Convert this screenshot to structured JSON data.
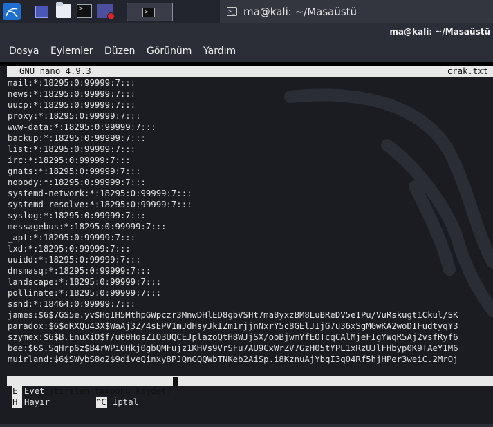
{
  "taskbar": {
    "terminal_glyph": ">_",
    "active_window_title": "ma@kali: ~/Masaüstü"
  },
  "window": {
    "title": "ma@kali: ~/Masaüstü"
  },
  "menu": [
    "Dosya",
    "Eylemler",
    "Düzen",
    "Görünüm",
    "Yardım"
  ],
  "nano": {
    "version": "GNU nano 4.9.3",
    "filename": "crak.txt",
    "lines": [
      "mail:*:18295:0:99999:7:::",
      "news:*:18295:0:99999:7:::",
      "uucp:*:18295:0:99999:7:::",
      "proxy:*:18295:0:99999:7:::",
      "www-data:*:18295:0:99999:7:::",
      "backup:*:18295:0:99999:7:::",
      "list:*:18295:0:99999:7:::",
      "irc:*:18295:0:99999:7:::",
      "gnats:*:18295:0:99999:7:::",
      "nobody:*:18295:0:99999:7:::",
      "systemd-network:*:18295:0:99999:7:::",
      "systemd-resolve:*:18295:0:99999:7:::",
      "syslog:*:18295:0:99999:7:::",
      "messagebus:*:18295:0:99999:7:::",
      "_apt:*:18295:0:99999:7:::",
      "lxd:*:18295:0:99999:7:::",
      "uuidd:*:18295:0:99999:7:::",
      "dnsmasq:*:18295:0:99999:7:::",
      "landscape:*:18295:0:99999:7:::",
      "pollinate:*:18295:0:99999:7:::",
      "sshd:*:18464:0:99999:7:::",
      "james:$6$7GS5e.yv$HqIH5MthpGWpczr3MnwDHlED8gbVSHt7ma8yxzBM8LuBReDV5e1Pu/VuRskugt1Ckul/SK",
      "paradox:$6$oRXQu43X$WaAj3Z/4sEPV1mJdHsyJkIZm1rjjnNxrY5c8GElJIjG7u36xSgMGwKA2woDIFudtyqY3",
      "szymex:$6$B.EnuXiO$f/u00HosZIO3UQCEJplazoQtH8WJjSX/ooBjwmYfEOTcqCAlMjeFIgYWqR5Aj2vsfRyf6",
      "bee:$6$.SqHrp6z$B4rWPi0Hkj0gbQMFujz1KHVs9VrSFu7AU9CxWrZV7GzH05tYPL1xRzUJlFHbyp0K9TAeY1M6",
      "muirland:$6$SWybS8o2$9diveQinxy8PJQnGQQWbTNKeb2AiSp.i8KznuAjYbqI3q04Rf5hjHPer3weiC.2MrOj"
    ],
    "prompt": "Değiştirilen tamponu kaydet?",
    "options": [
      {
        "key": "E",
        "label": "Evet"
      },
      {
        "key": "H",
        "label": "Hayır"
      },
      {
        "key": "^C",
        "label": "İptal"
      }
    ]
  }
}
